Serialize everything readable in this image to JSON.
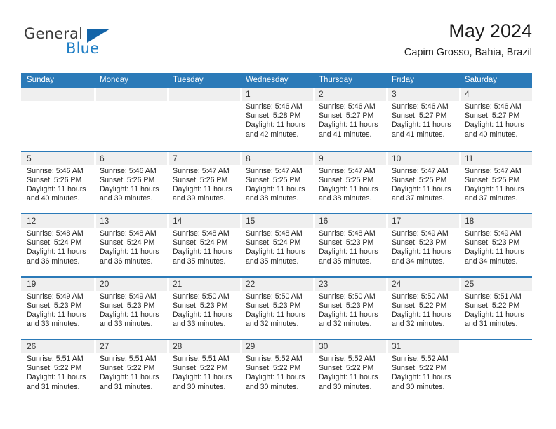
{
  "brand": {
    "name_top": "General",
    "name_bottom": "Blue",
    "triangle_color": "#1364a8",
    "blue_color": "#1d7dc4"
  },
  "header": {
    "title": "May 2024",
    "subtitle": "Capim Grosso, Bahia, Brazil"
  },
  "theme": {
    "header_blue": "#2b7ab8",
    "daynum_band": "#efefef"
  },
  "weekdays": [
    "Sunday",
    "Monday",
    "Tuesday",
    "Wednesday",
    "Thursday",
    "Friday",
    "Saturday"
  ],
  "weeks": [
    [
      {
        "day": "",
        "lines": []
      },
      {
        "day": "",
        "lines": []
      },
      {
        "day": "",
        "lines": []
      },
      {
        "day": "1",
        "lines": [
          "Sunrise: 5:46 AM",
          "Sunset: 5:28 PM",
          "Daylight: 11 hours",
          "and 42 minutes."
        ]
      },
      {
        "day": "2",
        "lines": [
          "Sunrise: 5:46 AM",
          "Sunset: 5:27 PM",
          "Daylight: 11 hours",
          "and 41 minutes."
        ]
      },
      {
        "day": "3",
        "lines": [
          "Sunrise: 5:46 AM",
          "Sunset: 5:27 PM",
          "Daylight: 11 hours",
          "and 41 minutes."
        ]
      },
      {
        "day": "4",
        "lines": [
          "Sunrise: 5:46 AM",
          "Sunset: 5:27 PM",
          "Daylight: 11 hours",
          "and 40 minutes."
        ]
      }
    ],
    [
      {
        "day": "5",
        "lines": [
          "Sunrise: 5:46 AM",
          "Sunset: 5:26 PM",
          "Daylight: 11 hours",
          "and 40 minutes."
        ]
      },
      {
        "day": "6",
        "lines": [
          "Sunrise: 5:46 AM",
          "Sunset: 5:26 PM",
          "Daylight: 11 hours",
          "and 39 minutes."
        ]
      },
      {
        "day": "7",
        "lines": [
          "Sunrise: 5:47 AM",
          "Sunset: 5:26 PM",
          "Daylight: 11 hours",
          "and 39 minutes."
        ]
      },
      {
        "day": "8",
        "lines": [
          "Sunrise: 5:47 AM",
          "Sunset: 5:25 PM",
          "Daylight: 11 hours",
          "and 38 minutes."
        ]
      },
      {
        "day": "9",
        "lines": [
          "Sunrise: 5:47 AM",
          "Sunset: 5:25 PM",
          "Daylight: 11 hours",
          "and 38 minutes."
        ]
      },
      {
        "day": "10",
        "lines": [
          "Sunrise: 5:47 AM",
          "Sunset: 5:25 PM",
          "Daylight: 11 hours",
          "and 37 minutes."
        ]
      },
      {
        "day": "11",
        "lines": [
          "Sunrise: 5:47 AM",
          "Sunset: 5:25 PM",
          "Daylight: 11 hours",
          "and 37 minutes."
        ]
      }
    ],
    [
      {
        "day": "12",
        "lines": [
          "Sunrise: 5:48 AM",
          "Sunset: 5:24 PM",
          "Daylight: 11 hours",
          "and 36 minutes."
        ]
      },
      {
        "day": "13",
        "lines": [
          "Sunrise: 5:48 AM",
          "Sunset: 5:24 PM",
          "Daylight: 11 hours",
          "and 36 minutes."
        ]
      },
      {
        "day": "14",
        "lines": [
          "Sunrise: 5:48 AM",
          "Sunset: 5:24 PM",
          "Daylight: 11 hours",
          "and 35 minutes."
        ]
      },
      {
        "day": "15",
        "lines": [
          "Sunrise: 5:48 AM",
          "Sunset: 5:24 PM",
          "Daylight: 11 hours",
          "and 35 minutes."
        ]
      },
      {
        "day": "16",
        "lines": [
          "Sunrise: 5:48 AM",
          "Sunset: 5:23 PM",
          "Daylight: 11 hours",
          "and 35 minutes."
        ]
      },
      {
        "day": "17",
        "lines": [
          "Sunrise: 5:49 AM",
          "Sunset: 5:23 PM",
          "Daylight: 11 hours",
          "and 34 minutes."
        ]
      },
      {
        "day": "18",
        "lines": [
          "Sunrise: 5:49 AM",
          "Sunset: 5:23 PM",
          "Daylight: 11 hours",
          "and 34 minutes."
        ]
      }
    ],
    [
      {
        "day": "19",
        "lines": [
          "Sunrise: 5:49 AM",
          "Sunset: 5:23 PM",
          "Daylight: 11 hours",
          "and 33 minutes."
        ]
      },
      {
        "day": "20",
        "lines": [
          "Sunrise: 5:49 AM",
          "Sunset: 5:23 PM",
          "Daylight: 11 hours",
          "and 33 minutes."
        ]
      },
      {
        "day": "21",
        "lines": [
          "Sunrise: 5:50 AM",
          "Sunset: 5:23 PM",
          "Daylight: 11 hours",
          "and 33 minutes."
        ]
      },
      {
        "day": "22",
        "lines": [
          "Sunrise: 5:50 AM",
          "Sunset: 5:23 PM",
          "Daylight: 11 hours",
          "and 32 minutes."
        ]
      },
      {
        "day": "23",
        "lines": [
          "Sunrise: 5:50 AM",
          "Sunset: 5:23 PM",
          "Daylight: 11 hours",
          "and 32 minutes."
        ]
      },
      {
        "day": "24",
        "lines": [
          "Sunrise: 5:50 AM",
          "Sunset: 5:22 PM",
          "Daylight: 11 hours",
          "and 32 minutes."
        ]
      },
      {
        "day": "25",
        "lines": [
          "Sunrise: 5:51 AM",
          "Sunset: 5:22 PM",
          "Daylight: 11 hours",
          "and 31 minutes."
        ]
      }
    ],
    [
      {
        "day": "26",
        "lines": [
          "Sunrise: 5:51 AM",
          "Sunset: 5:22 PM",
          "Daylight: 11 hours",
          "and 31 minutes."
        ]
      },
      {
        "day": "27",
        "lines": [
          "Sunrise: 5:51 AM",
          "Sunset: 5:22 PM",
          "Daylight: 11 hours",
          "and 31 minutes."
        ]
      },
      {
        "day": "28",
        "lines": [
          "Sunrise: 5:51 AM",
          "Sunset: 5:22 PM",
          "Daylight: 11 hours",
          "and 30 minutes."
        ]
      },
      {
        "day": "29",
        "lines": [
          "Sunrise: 5:52 AM",
          "Sunset: 5:22 PM",
          "Daylight: 11 hours",
          "and 30 minutes."
        ]
      },
      {
        "day": "30",
        "lines": [
          "Sunrise: 5:52 AM",
          "Sunset: 5:22 PM",
          "Daylight: 11 hours",
          "and 30 minutes."
        ]
      },
      {
        "day": "31",
        "lines": [
          "Sunrise: 5:52 AM",
          "Sunset: 5:22 PM",
          "Daylight: 11 hours",
          "and 30 minutes."
        ]
      },
      {
        "day": "",
        "lines": []
      }
    ]
  ]
}
